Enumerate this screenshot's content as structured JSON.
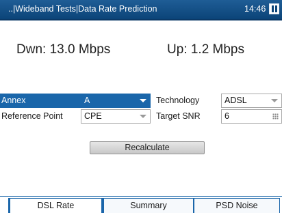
{
  "header": {
    "breadcrumb": "..|Wideband Tests|Data Rate Prediction",
    "time": "14:46",
    "pause_icon": "pause-icon"
  },
  "rates": {
    "down": "Dwn: 13.0 Mbps",
    "up": "Up: 1.2 Mbps"
  },
  "form": {
    "annex_label": "Annex",
    "annex_value": "A",
    "technology_label": "Technology",
    "technology_value": "ADSL",
    "reference_point_label": "Reference Point",
    "reference_point_value": "CPE",
    "target_snr_label": "Target SNR",
    "target_snr_value": "6"
  },
  "actions": {
    "recalculate_label": "Recalculate"
  },
  "tabs": [
    {
      "label": "DSL Rate",
      "active": true
    },
    {
      "label": "Summary",
      "active": false
    },
    {
      "label": "PSD Noise",
      "active": false
    }
  ],
  "colors": {
    "accent": "#1a66aa",
    "titlebar": "#0b4478"
  }
}
